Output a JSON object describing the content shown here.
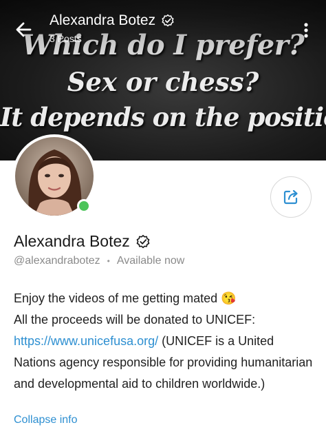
{
  "header": {
    "title": "Alexandra Botez",
    "subtitle": "3 Posts"
  },
  "banner": {
    "line1": "Which do I prefer?",
    "line2": "Sex or chess?",
    "line3": "It depends on the position."
  },
  "profile": {
    "name": "Alexandra Botez",
    "handle": "@alexandrabotez",
    "status": "Available now",
    "online": true
  },
  "bio": {
    "line1": "Enjoy the videos of me getting mated",
    "emoji": "😘",
    "line2": "All the proceeds will be donated to UNICEF:",
    "link": "https://www.unicefusa.org/",
    "line3": " (UNICEF is a United Nations agency responsible for providing humanitarian and developmental aid to children worldwide.)"
  },
  "collapse_label": "Collapse info",
  "icons": {
    "back": "arrow-left-icon",
    "verified": "verified-badge-icon",
    "menu": "vertical-dots-icon",
    "share": "share-icon"
  },
  "colors": {
    "accent": "#2d8fd1",
    "online": "#4cc45a"
  }
}
